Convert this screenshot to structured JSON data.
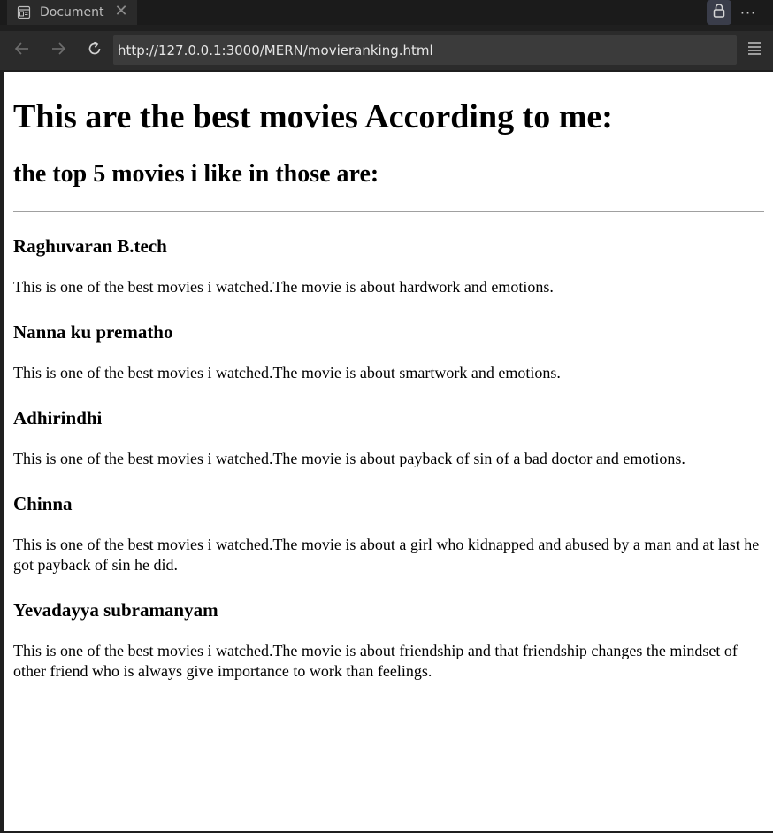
{
  "browser": {
    "tab": {
      "title": "Document",
      "close_glyph": "✕",
      "icon": "document-icon"
    },
    "toolbar": {
      "lock_icon": "lock-icon",
      "more_glyph": "···",
      "back_icon": "arrow-left-icon",
      "forward_icon": "arrow-right-icon",
      "reload_icon": "reload-icon",
      "menu_icon": "menu-icon"
    },
    "address": {
      "url": "http://127.0.0.1:3000/MERN/movieranking.html"
    },
    "colors": {
      "chrome_bg": "#1b1b1b",
      "tab_bg": "#2a2a2a",
      "nav_bg": "#2b2b2b",
      "address_bg": "#3b3b3b",
      "lock_bg": "#3a3d4a",
      "page_bg": "#ffffff"
    }
  },
  "page": {
    "heading": "This are the best movies According to me:",
    "subheading": "the top 5 movies i like in those are:",
    "movies": [
      {
        "title": "Raghuvaran B.tech",
        "description": "This is one of the best movies i watched.The movie is about hardwork and emotions."
      },
      {
        "title": "Nanna ku prematho",
        "description": "This is one of the best movies i watched.The movie is about smartwork and emotions."
      },
      {
        "title": "Adhirindhi",
        "description": "This is one of the best movies i watched.The movie is about payback of sin of a bad doctor and emotions."
      },
      {
        "title": "Chinna",
        "description": "This is one of the best movies i watched.The movie is about a girl who kidnapped and abused by a man and at last he got payback of sin he did."
      },
      {
        "title": "Yevadayya subramanyam",
        "description": "This is one of the best movies i watched.The movie is about friendship and that friendship changes the mindset of other friend who is always give importance to work than feelings."
      }
    ]
  }
}
